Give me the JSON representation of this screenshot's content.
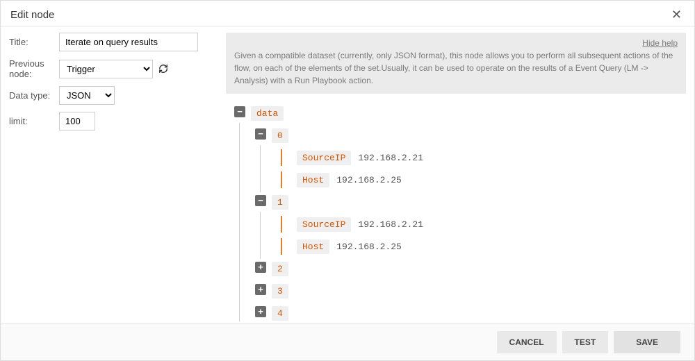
{
  "header": {
    "title": "Edit node"
  },
  "form": {
    "title_label": "Title:",
    "title_value": "Iterate on query results",
    "prev_label": "Previous node:",
    "prev_value": "Trigger",
    "dtype_label": "Data type:",
    "dtype_value": "JSON",
    "limit_label": "limit:",
    "limit_value": "100"
  },
  "help": {
    "hide_link": "Hide help",
    "text": "Given a compatible dataset (currently, only JSON format), this node allows you to perform all subsequent actions of the flow, on each of the elements of the set.Usually, it can be used to operate on the results of a Event Query (LM -> Analysis) with a Run Playbook action."
  },
  "tree": {
    "root_key": "data",
    "items": [
      {
        "i": "0",
        "open": true,
        "fields": [
          {
            "k": "SourceIP",
            "v": "192.168.2.21"
          },
          {
            "k": "Host",
            "v": "192.168.2.25"
          }
        ]
      },
      {
        "i": "1",
        "open": true,
        "fields": [
          {
            "k": "SourceIP",
            "v": "192.168.2.21"
          },
          {
            "k": "Host",
            "v": "192.168.2.25"
          }
        ]
      },
      {
        "i": "2",
        "open": false,
        "fields": []
      },
      {
        "i": "3",
        "open": false,
        "fields": []
      },
      {
        "i": "4",
        "open": false,
        "fields": []
      }
    ]
  },
  "buttons": {
    "cancel": "CANCEL",
    "test": "TEST",
    "save": "SAVE"
  },
  "tog": {
    "minus": "−",
    "plus": "+"
  }
}
